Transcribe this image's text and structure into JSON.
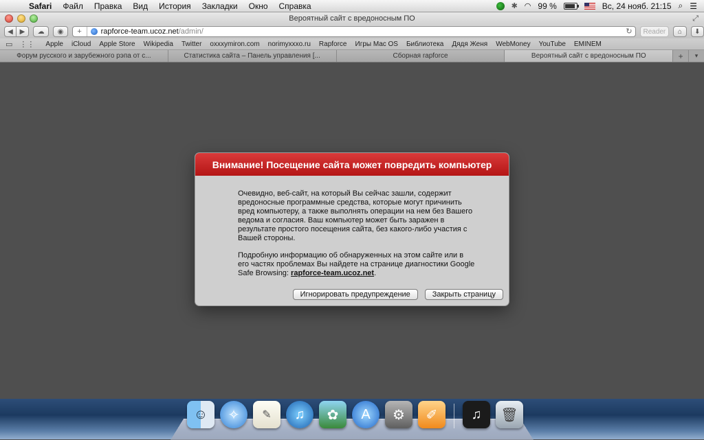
{
  "menubar": {
    "app": "Safari",
    "items": [
      "Файл",
      "Правка",
      "Вид",
      "История",
      "Закладки",
      "Окно",
      "Справка"
    ],
    "battery": "99 %",
    "battery_level": 0.99,
    "datetime": "Вс, 24 нояб.  21:15"
  },
  "window": {
    "title": "Вероятный сайт с вредоносным ПО"
  },
  "toolbar": {
    "url_host": "rapforce-team.ucoz.net",
    "url_path": "/admin/",
    "reader_label": "Reader"
  },
  "bookmarks": [
    "Apple",
    "iCloud",
    "Apple Store",
    "Wikipedia",
    "Twitter",
    "oxxxymiron.com",
    "norimyxxxo.ru",
    "Rapforce",
    "Игры Mac OS",
    "Библиотека",
    "Дядя Женя",
    "WebMoney",
    "YouTube",
    "EMINEM"
  ],
  "tabs": [
    {
      "label": "Форум русского и зарубежного рэпа от с..."
    },
    {
      "label": "Статистика сайта – Панель управления [..."
    },
    {
      "label": "Сборная rapforce"
    },
    {
      "label": "Вероятный сайт с вредоносным ПО"
    }
  ],
  "dialog": {
    "title": "Внимание! Посещение сайта может повредить компьютер",
    "paragraph1": "Очевидно, веб-сайт, на который Вы сейчас зашли, содержит вредоносные программные средства, которые могут причинить вред компьютеру, а также выполнять операции на нем без Вашего ведома и согласия. Ваш компьютер может быть заражен в результате простого посещения сайта, без какого-либо участия с Вашей стороны.",
    "paragraph2": "Подробную информацию об обнаруженных на этом сайте или в его частях проблемах Вы найдете на странице диагностики Google Safe Browsing:",
    "link": "rapforce-team.ucoz.net",
    "ignore_button": "Игнорировать предупреждение",
    "close_button": "Закрыть страницу"
  },
  "dock": {
    "icons": [
      "finder-icon",
      "safari-icon",
      "textedit-icon",
      "itunes-icon",
      "iphoto-icon",
      "app-store-icon",
      "system-preferences-icon",
      "pages-icon",
      "music-file-icon",
      "trash-icon"
    ]
  },
  "colors": {
    "dialog_header": "#c62020",
    "content_bg": "#4f4f4f"
  }
}
